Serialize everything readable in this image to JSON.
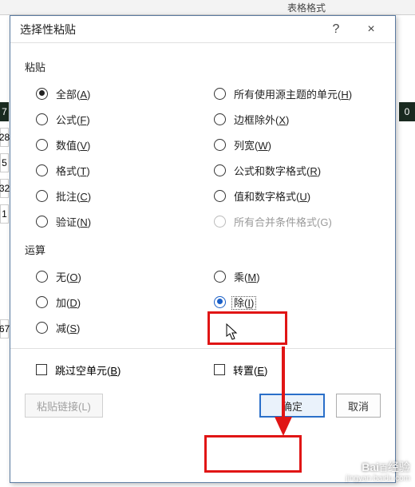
{
  "ribbon": {
    "group_label": "表格格式"
  },
  "dialog": {
    "title": "选择性粘贴",
    "help_glyph": "?",
    "close_glyph": "×"
  },
  "sections": {
    "paste": "粘贴",
    "operation": "运算"
  },
  "paste_options": {
    "left": [
      {
        "label": "全部",
        "key": "A",
        "selected": true
      },
      {
        "label": "公式",
        "key": "F"
      },
      {
        "label": "数值",
        "key": "V"
      },
      {
        "label": "格式",
        "key": "T"
      },
      {
        "label": "批注",
        "key": "C"
      },
      {
        "label": "验证",
        "key": "N"
      }
    ],
    "right": [
      {
        "label": "所有使用源主题的单元",
        "key": "H"
      },
      {
        "label": "边框除外",
        "key": "X"
      },
      {
        "label": "列宽",
        "key": "W"
      },
      {
        "label": "公式和数字格式",
        "key": "R"
      },
      {
        "label": "值和数字格式",
        "key": "U"
      },
      {
        "label": "所有合并条件格式(G)",
        "key": "",
        "disabled": true
      }
    ]
  },
  "op_options": {
    "left": [
      {
        "label": "无",
        "key": "O"
      },
      {
        "label": "加",
        "key": "D"
      },
      {
        "label": "减",
        "key": "S"
      }
    ],
    "right": [
      {
        "label": "乘",
        "key": "M"
      },
      {
        "label": "除",
        "key": "I",
        "selected": true
      }
    ]
  },
  "checkboxes": {
    "skip_blanks": {
      "label": "跳过空单元",
      "key": "B"
    },
    "transpose": {
      "label": "转置",
      "key": "E"
    }
  },
  "buttons": {
    "paste_link": "粘贴链接(L)",
    "ok": "确定",
    "cancel": "取消"
  },
  "bg_cells": {
    "c1": "7",
    "c2": "28",
    "c3": "5",
    "c4": "32",
    "c5": "1",
    "c6": "67",
    "c7": "0"
  },
  "watermark": {
    "brand": "Bai",
    "brand2": "经验",
    "url": "jingyan.baidu.com"
  }
}
